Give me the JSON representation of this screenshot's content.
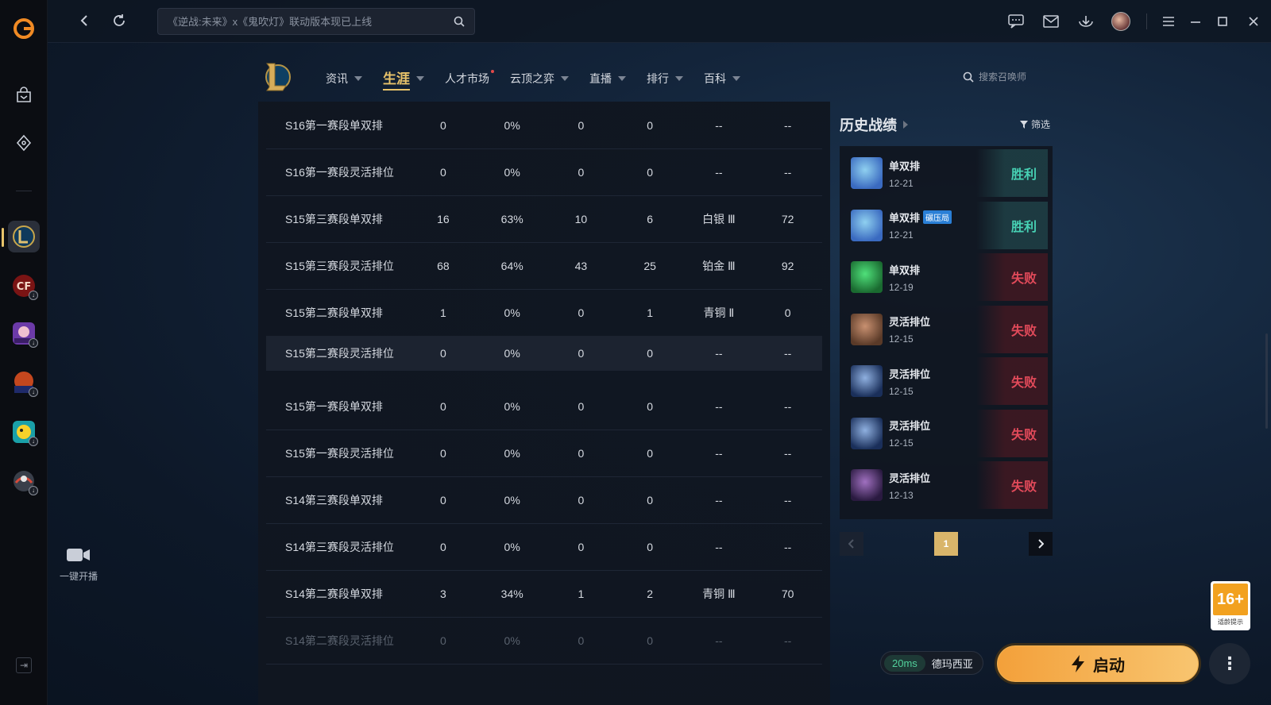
{
  "window": {
    "title": "WeGame"
  },
  "sidebar": {
    "games": [
      {
        "name": "League of Legends",
        "icon": "lol-icon",
        "active": true
      },
      {
        "name": "CrossFire",
        "icon": "cf-icon"
      },
      {
        "name": "Game 3",
        "icon": "game-icon"
      },
      {
        "name": "NBA2K Online",
        "icon": "nba-icon"
      },
      {
        "name": "Game 5",
        "icon": "game-icon"
      },
      {
        "name": "Game 6",
        "icon": "game-icon"
      }
    ],
    "golive_label": "一键开播"
  },
  "topbar": {
    "search_placeholder": "《逆战:未来》x《鬼吹灯》联动版本现已上线"
  },
  "game_nav": {
    "items": [
      {
        "label": "资讯",
        "caret": true
      },
      {
        "label": "生涯",
        "caret": true,
        "active": true
      },
      {
        "label": "人才市场",
        "caret": false,
        "dot": true
      },
      {
        "label": "云顶之弈",
        "caret": true
      },
      {
        "label": "直播",
        "caret": true
      },
      {
        "label": "排行",
        "caret": true
      },
      {
        "label": "百科",
        "caret": true
      }
    ],
    "summoner_search_placeholder": "搜索召唤师"
  },
  "career_table": {
    "rows": [
      [
        "S16第一赛段单双排",
        "0",
        "0%",
        "0",
        "0",
        "--",
        "--"
      ],
      [
        "S16第一赛段灵活排位",
        "0",
        "0%",
        "0",
        "0",
        "--",
        "--"
      ],
      [
        "S15第三赛段单双排",
        "16",
        "63%",
        "10",
        "6",
        "白银 Ⅲ",
        "72"
      ],
      [
        "S15第三赛段灵活排位",
        "68",
        "64%",
        "43",
        "25",
        "铂金 Ⅲ",
        "92"
      ],
      [
        "S15第二赛段单双排",
        "1",
        "0%",
        "0",
        "1",
        "青铜 Ⅱ",
        "0"
      ],
      [
        "S15第二赛段灵活排位",
        "0",
        "0%",
        "0",
        "0",
        "--",
        "--"
      ],
      [
        "S15第一赛段单双排",
        "0",
        "0%",
        "0",
        "0",
        "--",
        "--"
      ],
      [
        "S15第一赛段灵活排位",
        "0",
        "0%",
        "0",
        "0",
        "--",
        "--"
      ],
      [
        "S14第三赛段单双排",
        "0",
        "0%",
        "0",
        "0",
        "--",
        "--"
      ],
      [
        "S14第三赛段灵活排位",
        "0",
        "0%",
        "0",
        "0",
        "--",
        "--"
      ],
      [
        "S14第二赛段单双排",
        "3",
        "34%",
        "1",
        "2",
        "青铜 Ⅲ",
        "70"
      ],
      [
        "S14第二赛段灵活排位",
        "0",
        "0%",
        "0",
        "0",
        "--",
        "--"
      ]
    ]
  },
  "history": {
    "title": "历史战绩",
    "filter_label": "筛选",
    "matches": [
      {
        "mode": "单双排",
        "date": "12-21",
        "result": "胜利",
        "win": true,
        "tag": ""
      },
      {
        "mode": "单双排",
        "date": "12-21",
        "result": "胜利",
        "win": true,
        "tag": "碾压局"
      },
      {
        "mode": "单双排",
        "date": "12-19",
        "result": "失败",
        "win": false,
        "tag": ""
      },
      {
        "mode": "灵活排位",
        "date": "12-15",
        "result": "失败",
        "win": false,
        "tag": ""
      },
      {
        "mode": "灵活排位",
        "date": "12-15",
        "result": "失败",
        "win": false,
        "tag": ""
      },
      {
        "mode": "灵活排位",
        "date": "12-15",
        "result": "失败",
        "win": false,
        "tag": ""
      },
      {
        "mode": "灵活排位",
        "date": "12-13",
        "result": "失败",
        "win": false,
        "tag": ""
      }
    ],
    "pager": {
      "current": "1"
    }
  },
  "age_rating": {
    "value": "16+",
    "note": "适龄提示"
  },
  "launch": {
    "ping": "20ms",
    "server": "德玛西亚",
    "button_label": "启动"
  },
  "colors": {
    "accent_gold": "#e8c36a",
    "win": "#47d1b4",
    "loss": "#e24a5a",
    "launch": "#f3a03a"
  }
}
